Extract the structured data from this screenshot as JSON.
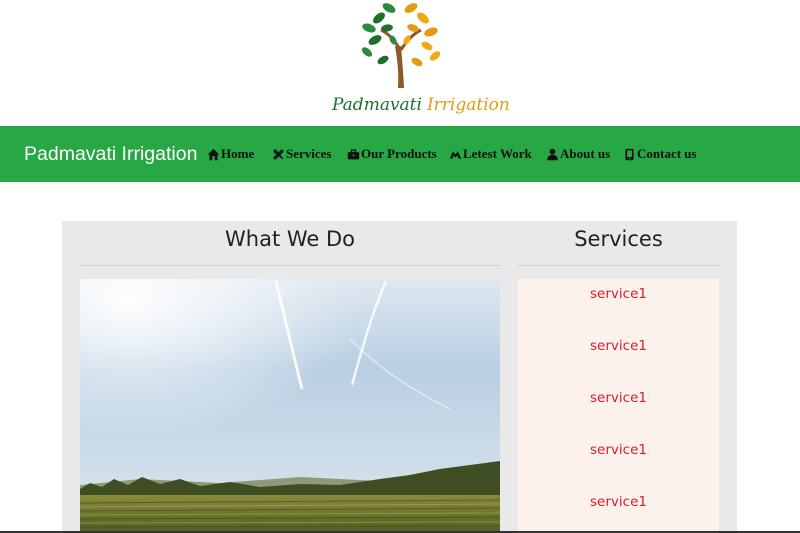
{
  "logo": {
    "word1": "Padmavati",
    "word2": "Irrigation",
    "colors": {
      "green": "#1f6e2c",
      "orange": "#e39b12"
    }
  },
  "navbar": {
    "brand": "Padmavati Irrigation",
    "background": "#28a745",
    "items": [
      {
        "label": "Home",
        "icon": "home-icon"
      },
      {
        "label": "Services",
        "icon": "tools-icon"
      },
      {
        "label": "Our Products",
        "icon": "briefcase-icon"
      },
      {
        "label": "Letest Work",
        "icon": "handshake-icon"
      },
      {
        "label": "About us",
        "icon": "user-icon"
      },
      {
        "label": "Contact us",
        "icon": "phone-icon"
      }
    ]
  },
  "main": {
    "what_we_do_title": "What We Do",
    "services_title": "Services",
    "photo": "farm-field-image",
    "services": [
      "service1",
      "service1",
      "service1",
      "service1",
      "service1"
    ]
  }
}
